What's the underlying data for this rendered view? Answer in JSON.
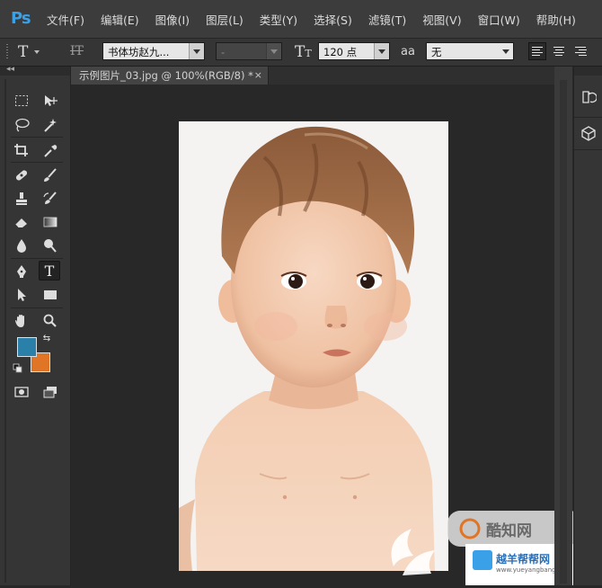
{
  "app": {
    "logo": "Ps",
    "accent": "#3aa0e8"
  },
  "menu": [
    "文件(F)",
    "编辑(E)",
    "图像(I)",
    "图层(L)",
    "类型(Y)",
    "选择(S)",
    "滤镜(T)",
    "视图(V)",
    "窗口(W)",
    "帮助(H)"
  ],
  "options": {
    "tool_icon": "T",
    "font_family": "书体坊赵九...",
    "font_style": "-",
    "font_size": "120 点",
    "antialias_label": "aa",
    "antialias_value": "无",
    "align": [
      "left",
      "center",
      "right"
    ],
    "align_active": "left"
  },
  "document": {
    "tab_title": "示例图片_03.jpg @ 100%(RGB/8) *",
    "close_glyph": "×"
  },
  "toolbar": {
    "collapse_glyph": "◂◂",
    "foreground_color": "#2a80a8",
    "background_color": "#e07526"
  },
  "watermark": {
    "text1": "酷知网",
    "text2": "越羊帮帮网",
    "url": "www.yueyangbang.com"
  }
}
